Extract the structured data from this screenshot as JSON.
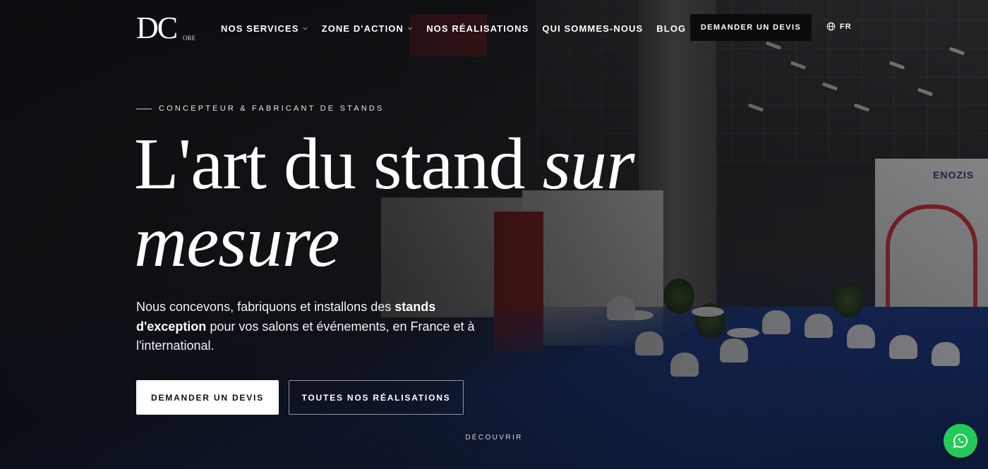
{
  "header": {
    "logo": {
      "mark": "DC",
      "sub": "ORE"
    },
    "nav": [
      {
        "label": "NOS SERVICES",
        "has_dropdown": true,
        "dropdown_icon": "chevron-down-icon"
      },
      {
        "label": "ZONE D'ACTION",
        "has_dropdown": true,
        "dropdown_icon": "chevron-down-icon"
      },
      {
        "label": "NOS RÉALISATIONS",
        "has_dropdown": false
      },
      {
        "label": "QUI SOMMES-NOUS",
        "has_dropdown": false
      },
      {
        "label": "BLOG",
        "has_dropdown": true,
        "dropdown_icon": "chevron-down-icon"
      }
    ],
    "cta_label": "DEMANDER UN DEVIS",
    "language": {
      "icon": "globe-icon",
      "label": "FR"
    }
  },
  "hero": {
    "eyebrow": "CONCEPTEUR & FABRICANT DE STANDS",
    "headline_plain": "L'art du stand ",
    "headline_italic": "sur mesure",
    "lead_part1": "Nous concevons, fabriquons et installons des ",
    "lead_bold": "stands d'exception",
    "lead_part2": " pour vos salons et événements, en France et à l'international.",
    "primary_button": "DEMANDER UN DEVIS",
    "secondary_button": "TOUTES NOS RÉALISATIONS",
    "discover_label": "DÉCOUVRIR"
  },
  "floating": {
    "whatsapp_icon": "whatsapp-icon",
    "color": "#25c95a"
  },
  "colors": {
    "background_overlay": "#0a0b0e",
    "text": "#ffffff",
    "primary_button_bg": "#ffffff",
    "top_cta_bg": "#0b0b0c"
  }
}
